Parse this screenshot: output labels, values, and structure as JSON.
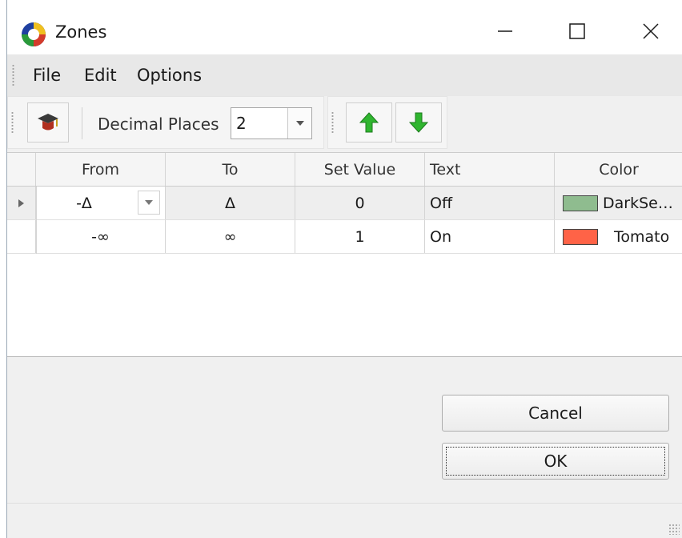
{
  "window": {
    "title": "Zones"
  },
  "menu": {
    "items": [
      "File",
      "Edit",
      "Options"
    ]
  },
  "toolbar": {
    "decimal_places_label": "Decimal Places",
    "decimal_places_value": "2",
    "icons": [
      "graduation-icon",
      "arrow-up-icon",
      "arrow-down-icon"
    ]
  },
  "grid": {
    "columns": [
      "From",
      "To",
      "Set Value",
      "Text",
      "Color"
    ],
    "rows": [
      {
        "from": "-Δ",
        "to": "Δ",
        "set_value": "0",
        "text": "Off",
        "color_name": "DarkSe…",
        "color_hex": "#8fbc8f"
      },
      {
        "from": "-∞",
        "to": "∞",
        "set_value": "1",
        "text": "On",
        "color_name": "Tomato",
        "color_hex": "#ff6347"
      }
    ]
  },
  "buttons": {
    "cancel": "Cancel",
    "ok": "OK"
  },
  "colors": {
    "accent_green": "#2fb52f",
    "window_bg": "#f0f0f0"
  }
}
